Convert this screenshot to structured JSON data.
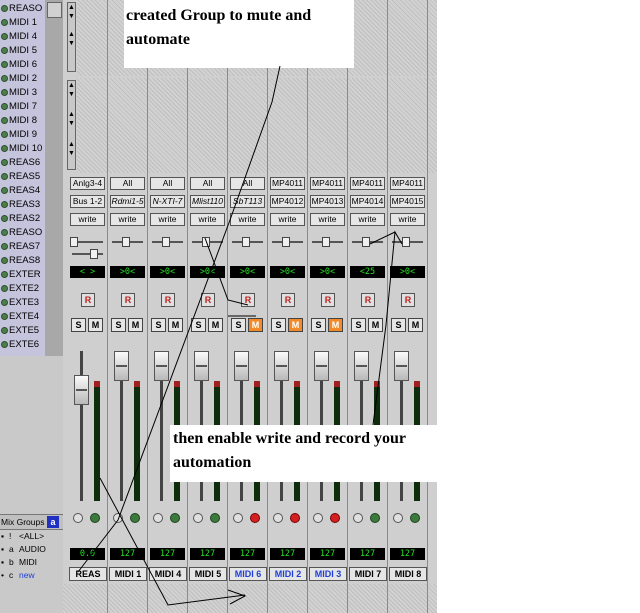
{
  "tracks": [
    "REASO",
    "MIDI 1",
    "MIDI 4",
    "MIDI 5",
    "MIDI 6",
    "MIDI 2",
    "MIDI 3",
    "MIDI 7",
    "MIDI 8",
    "MIDI 9",
    "MIDI 10",
    "REAS6",
    "REAS5",
    "REAS4",
    "REAS3",
    "REAS2",
    "REASO",
    "REAS7",
    "REAS8",
    "EXTER",
    "EXTE2",
    "EXTE3",
    "EXTE4",
    "EXTE5",
    "EXTE6"
  ],
  "mix_groups": {
    "header": "Mix Groups",
    "button": "a",
    "items": [
      {
        "icon": "▪",
        "key": "!",
        "name": "<ALL>"
      },
      {
        "icon": "▪",
        "key": "a",
        "name": "AUDIO"
      },
      {
        "icon": "▪",
        "key": "b",
        "name": "MIDI"
      },
      {
        "icon": "•",
        "key": "c",
        "name": "new"
      }
    ]
  },
  "strips": [
    {
      "input": "Anlg3-4",
      "output": "Bus 1-2",
      "output_italic": false,
      "auto": "write",
      "pan": "< >",
      "mute_on": false,
      "vol": "0.0",
      "name": "REAS",
      "selected": false
    },
    {
      "input": "All",
      "output": "Rdmi1-5",
      "output_italic": true,
      "auto": "write",
      "pan": ">0<",
      "mute_on": false,
      "vol": "127",
      "name": "MIDI 1",
      "selected": false
    },
    {
      "input": "All",
      "output": "N-XTI-7",
      "output_italic": true,
      "auto": "write",
      "pan": ">0<",
      "mute_on": false,
      "vol": "127",
      "name": "MIDI 4",
      "selected": false
    },
    {
      "input": "All",
      "output": "Mlist110",
      "output_italic": true,
      "auto": "write",
      "pan": ">0<",
      "mute_on": false,
      "vol": "127",
      "name": "MIDI 5",
      "selected": false
    },
    {
      "input": "All",
      "output": "SbT113",
      "output_italic": true,
      "auto": "write",
      "pan": ">0<",
      "mute_on": true,
      "vol": "127",
      "name": "MIDI 6",
      "selected": true
    },
    {
      "input": "MP4011",
      "output": "MP4012",
      "output_italic": false,
      "auto": "write",
      "pan": ">0<",
      "mute_on": true,
      "vol": "127",
      "name": "MIDI 2",
      "selected": true
    },
    {
      "input": "MP4011",
      "output": "MP4013",
      "output_italic": false,
      "auto": "write",
      "pan": ">0<",
      "mute_on": true,
      "vol": "127",
      "name": "MIDI 3",
      "selected": true
    },
    {
      "input": "MP4011",
      "output": "MP4014",
      "output_italic": false,
      "auto": "write",
      "pan": "<25",
      "mute_on": false,
      "vol": "127",
      "name": "MIDI 7",
      "selected": false
    },
    {
      "input": "MP4011",
      "output": "MP4015",
      "output_italic": false,
      "auto": "write",
      "pan": ">0<",
      "mute_on": false,
      "vol": "127",
      "name": "MIDI 8",
      "selected": false
    }
  ],
  "labels": {
    "rec": "R",
    "solo": "S",
    "mute": "M",
    "v": "v"
  },
  "callouts": {
    "first": "created Group to mute and automate",
    "second": "then enable write and record your automation"
  }
}
